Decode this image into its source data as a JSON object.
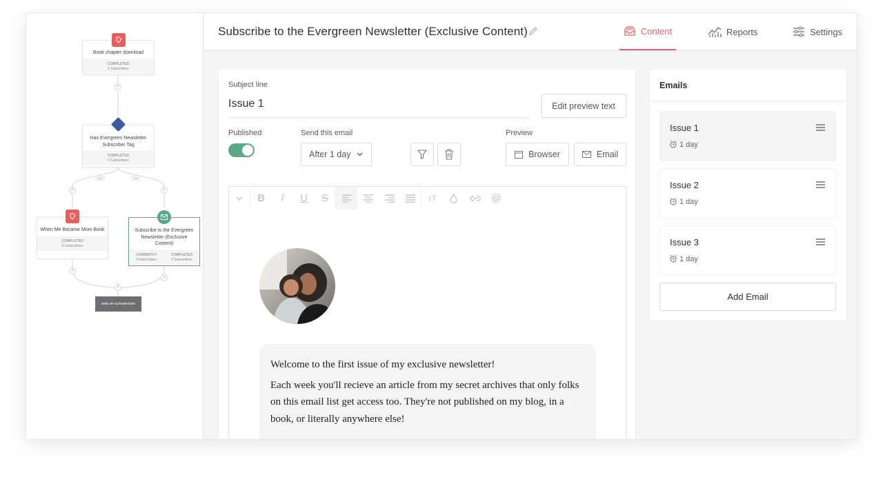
{
  "flow": {
    "node1": {
      "title": "Book chapter download",
      "stat_label": "COMPLETED",
      "stat_value": "0 Subscribers"
    },
    "node2": {
      "title": "Has Evergreen Newsletter Subscriber Tag",
      "stat_label": "COMPLETED",
      "stat_value": "0 Subscribers"
    },
    "node3": {
      "title": "When Me Became Mom Book",
      "stat_label": "COMPLETED",
      "stat_value": "0 Subscribers"
    },
    "node4": {
      "title": "Subscribe to the Evergreen Newsletter (Exclusive Content)",
      "stat1_label": "CURRENTLY",
      "stat1_value": "0 Subscribers",
      "stat2_label": "COMPLETED",
      "stat2_value": "0 Subscribers"
    },
    "branch_yes": "YES",
    "branch_no": "NO",
    "end_label": "END OF AUTOMATION"
  },
  "header": {
    "title": "Subscribe to the Evergreen Newsletter (Exclusive Content)",
    "tabs": [
      {
        "label": "Content",
        "icon": "inbox-icon",
        "active": true
      },
      {
        "label": "Reports",
        "icon": "chart-icon",
        "active": false
      },
      {
        "label": "Settings",
        "icon": "sliders-icon",
        "active": false
      }
    ]
  },
  "editor": {
    "subject_label": "Subject line",
    "subject_value": "Issue 1",
    "preview_text_button": "Edit preview text",
    "published_label": "Published",
    "send_label": "Send this email",
    "send_value": "After 1 day",
    "preview_label": "Preview",
    "browser_button": "Browser",
    "email_button": "Email",
    "body": {
      "line1": "Welcome to the first issue of my exclusive newsletter!",
      "line2": "Each week you'll recieve an article from my secret archives that only folks on this email list get access too. They're not published on my blog, in a book, or literally anywhere else!"
    }
  },
  "emails": {
    "title": "Emails",
    "items": [
      {
        "name": "Issue 1",
        "delay": "1 day"
      },
      {
        "name": "Issue 2",
        "delay": "1 day"
      },
      {
        "name": "Issue 3",
        "delay": "1 day"
      }
    ],
    "add_button": "Add Email"
  },
  "colors": {
    "accent": "#e55f5f",
    "green": "#5aa886",
    "navy": "#3f5ba0"
  }
}
